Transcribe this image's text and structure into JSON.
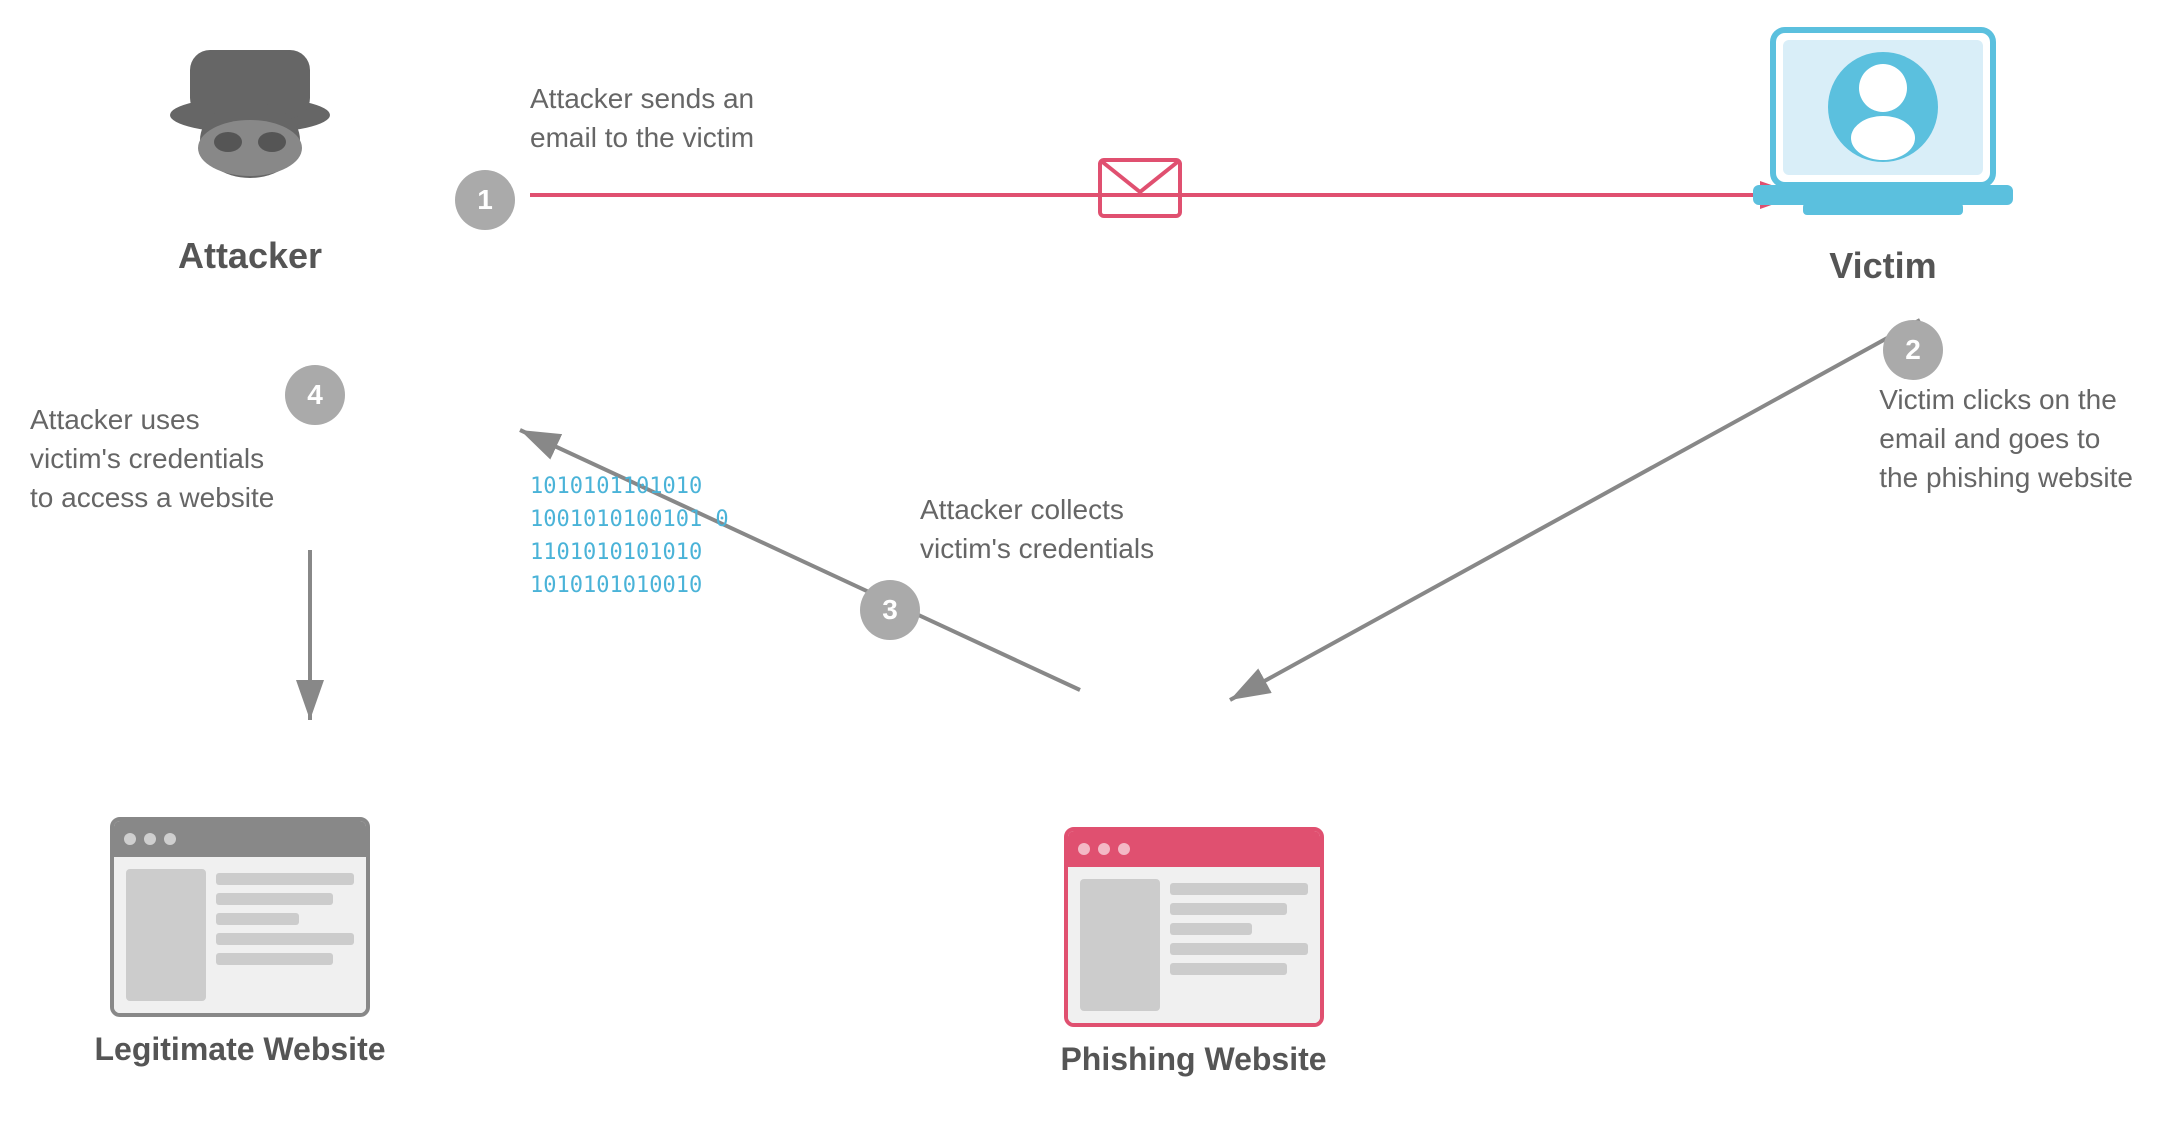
{
  "attacker": {
    "label": "Attacker"
  },
  "victim": {
    "label": "Victim"
  },
  "legit_website": {
    "label": "Legitimate Website"
  },
  "phishing_website": {
    "label": "Phishing Website"
  },
  "step1": {
    "number": "1",
    "annotation": "Attacker sends an\nemail to the victim"
  },
  "step2": {
    "number": "2",
    "annotation": "Victim clicks on the\nemail and goes to\nthe phishing website"
  },
  "step3": {
    "number": "3",
    "annotation": "Attacker collects\nvictim's credentials"
  },
  "step4": {
    "number": "4",
    "annotation": "Attacker uses\nvictim's credentials\nto access a website"
  },
  "binary": "1010101101010\n1001010100101 0\n1101010101010\n1010101010010"
}
